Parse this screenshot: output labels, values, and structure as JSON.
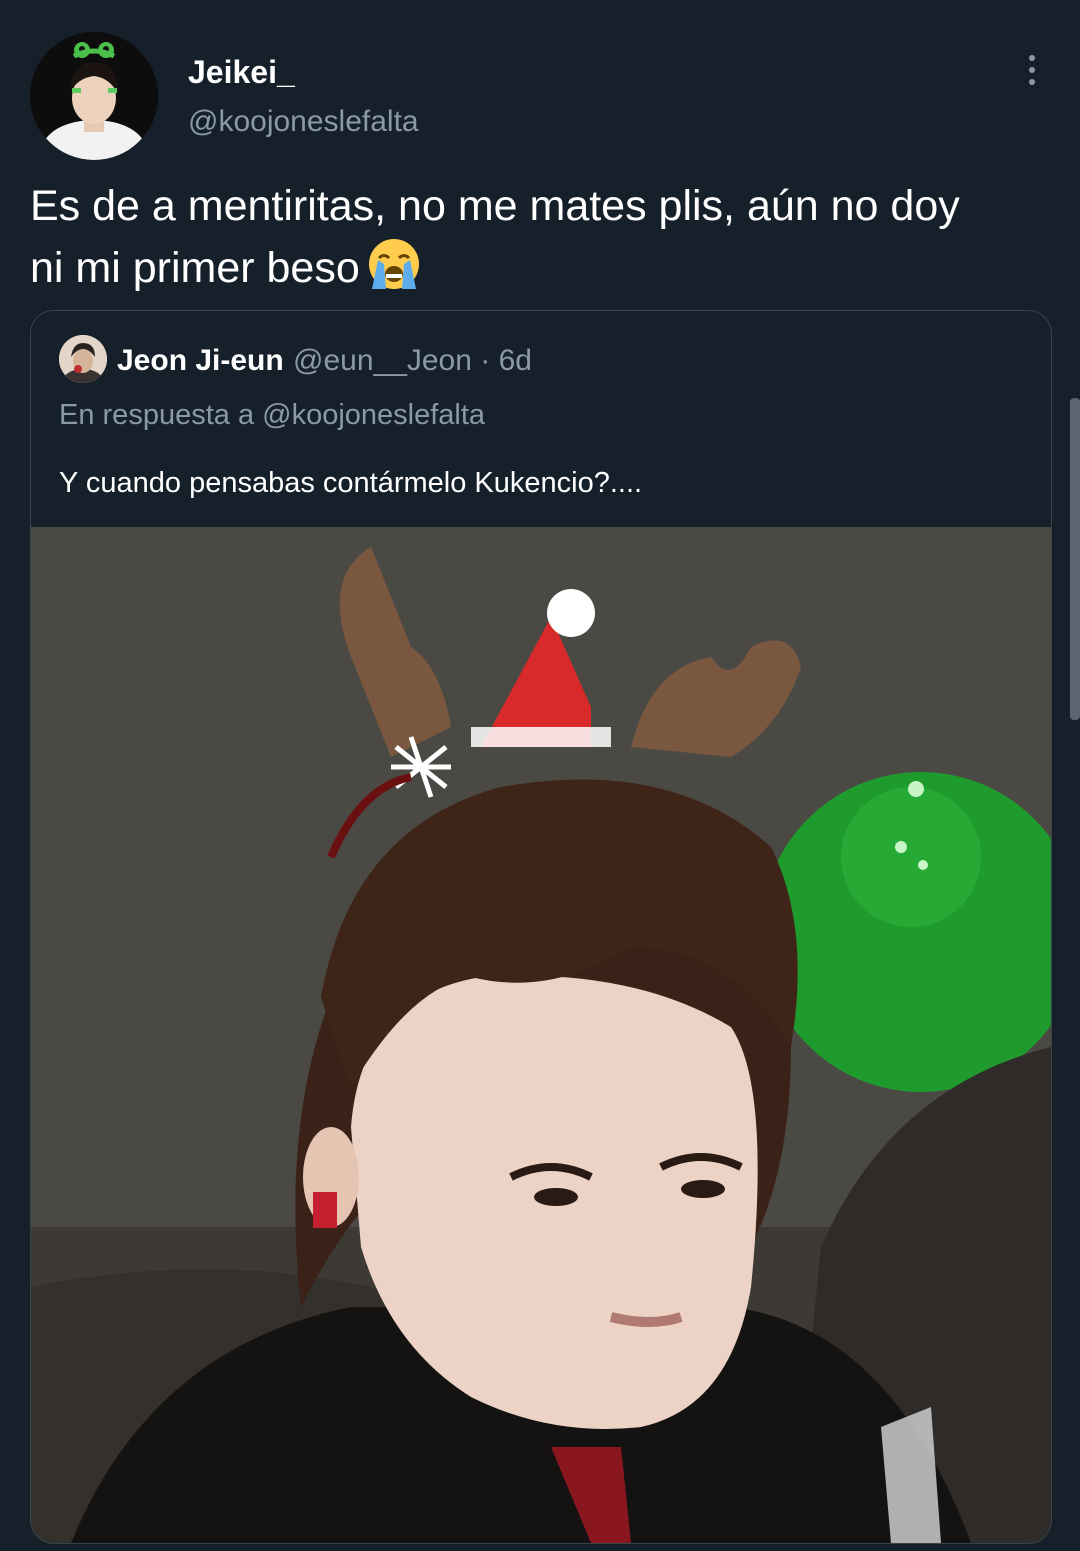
{
  "author": {
    "display_name": "Jeikei_",
    "handle": "@koojoneslefalta"
  },
  "tweet": {
    "text_line1": "Es de a mentiritas, no me mates plis, aún no doy",
    "text_line2": "ni mi primer beso",
    "emoji": "loudly-crying-face"
  },
  "quoted": {
    "display_name": "Jeon Ji-eun",
    "meta": "@eun__Jeon · 6d",
    "reply_to": "En respuesta a @koojoneslefalta",
    "text": "Y cuando pensabas contármelo Kukencio?...."
  },
  "colors": {
    "background": "#15202b",
    "border": "#38444d",
    "secondary_text": "#8b98a5"
  }
}
